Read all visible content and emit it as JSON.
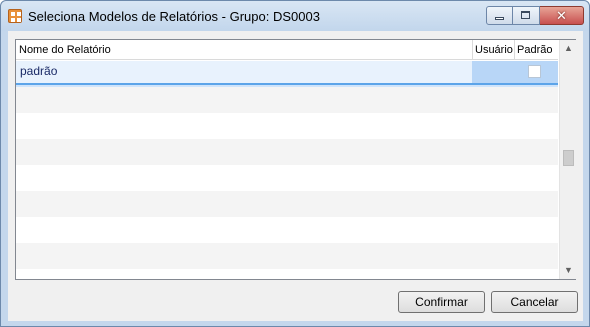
{
  "window": {
    "title": "Seleciona Modelos de Relatórios - Grupo: DS0003",
    "close_glyph": "✕"
  },
  "grid": {
    "columns": [
      {
        "label": "Nome do Relatório"
      },
      {
        "label": "Usuário"
      },
      {
        "label": "Padrão"
      }
    ],
    "rows": [
      {
        "name": "padrão",
        "padrao_checked": false
      }
    ]
  },
  "scrollbar": {
    "up_glyph": "▲",
    "down_glyph": "▼"
  },
  "buttons": {
    "confirm_label": "Confirmar",
    "cancel_label": "Cancelar"
  },
  "colors": {
    "selection": "#cfe4fb",
    "selection_border": "#5ca4e9",
    "title_bar": "#c4d7ec",
    "close_button": "#c75050"
  }
}
